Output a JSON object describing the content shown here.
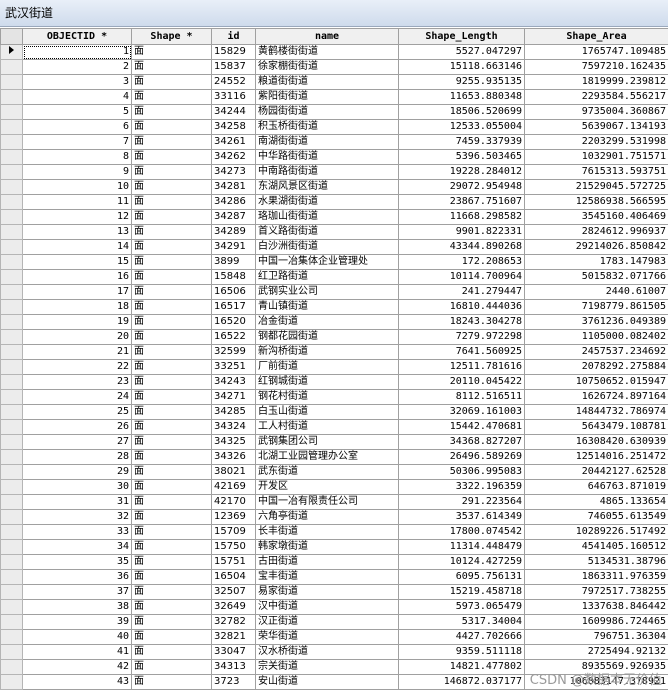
{
  "window": {
    "title": "武汉街道"
  },
  "columns": [
    "OBJECTID *",
    "Shape *",
    "id",
    "name",
    "Shape_Length",
    "Shape_Area"
  ],
  "rows": [
    {
      "oid": "1",
      "shape": "面",
      "id": "15829",
      "name": "黄鹤楼街街道",
      "len": "5527.047297",
      "area": "1765747.109485"
    },
    {
      "oid": "2",
      "shape": "面",
      "id": "15837",
      "name": "徐家棚街街道",
      "len": "15118.663146",
      "area": "7597210.162435"
    },
    {
      "oid": "3",
      "shape": "面",
      "id": "24552",
      "name": "粮道街街道",
      "len": "9255.935135",
      "area": "1819999.239812"
    },
    {
      "oid": "4",
      "shape": "面",
      "id": "33116",
      "name": "紫阳街街道",
      "len": "11653.880348",
      "area": "2293584.556217"
    },
    {
      "oid": "5",
      "shape": "面",
      "id": "34244",
      "name": "杨园街街道",
      "len": "18506.520699",
      "area": "9735004.360867"
    },
    {
      "oid": "6",
      "shape": "面",
      "id": "34258",
      "name": "积玉桥街街道",
      "len": "12533.055004",
      "area": "5639067.134193"
    },
    {
      "oid": "7",
      "shape": "面",
      "id": "34261",
      "name": "南湖街街道",
      "len": "7459.337939",
      "area": "2203299.531998"
    },
    {
      "oid": "8",
      "shape": "面",
      "id": "34262",
      "name": "中华路街街道",
      "len": "5396.503465",
      "area": "1032901.751571"
    },
    {
      "oid": "9",
      "shape": "面",
      "id": "34273",
      "name": "中南路街街道",
      "len": "19228.284012",
      "area": "7615313.593751"
    },
    {
      "oid": "10",
      "shape": "面",
      "id": "34281",
      "name": "东湖风景区街道",
      "len": "29072.954948",
      "area": "21529045.572725"
    },
    {
      "oid": "11",
      "shape": "面",
      "id": "34286",
      "name": "水果湖街街道",
      "len": "23867.751607",
      "area": "12586938.566595"
    },
    {
      "oid": "12",
      "shape": "面",
      "id": "34287",
      "name": "珞珈山街街道",
      "len": "11668.298582",
      "area": "3545160.406469"
    },
    {
      "oid": "13",
      "shape": "面",
      "id": "34289",
      "name": "首义路街街道",
      "len": "9901.822331",
      "area": "2824612.996937"
    },
    {
      "oid": "14",
      "shape": "面",
      "id": "34291",
      "name": "白沙洲街街道",
      "len": "43344.890268",
      "area": "29214026.850842"
    },
    {
      "oid": "15",
      "shape": "面",
      "id": "3899",
      "name": "中国一冶集体企业管理处",
      "len": "172.208653",
      "area": "1783.147983"
    },
    {
      "oid": "16",
      "shape": "面",
      "id": "15848",
      "name": "红卫路街道",
      "len": "10114.700964",
      "area": "5015832.071766"
    },
    {
      "oid": "17",
      "shape": "面",
      "id": "16506",
      "name": "武钢实业公司",
      "len": "241.279447",
      "area": "2440.61007"
    },
    {
      "oid": "18",
      "shape": "面",
      "id": "16517",
      "name": "青山镇街道",
      "len": "16810.444036",
      "area": "7198779.861505"
    },
    {
      "oid": "19",
      "shape": "面",
      "id": "16520",
      "name": "冶金街道",
      "len": "18243.304278",
      "area": "3761236.049389"
    },
    {
      "oid": "20",
      "shape": "面",
      "id": "16522",
      "name": "钢都花园街道",
      "len": "7279.972298",
      "area": "1105000.082402"
    },
    {
      "oid": "21",
      "shape": "面",
      "id": "32599",
      "name": "新沟桥街道",
      "len": "7641.560925",
      "area": "2457537.234692"
    },
    {
      "oid": "22",
      "shape": "面",
      "id": "33251",
      "name": "厂前街道",
      "len": "12511.781616",
      "area": "2078292.275884"
    },
    {
      "oid": "23",
      "shape": "面",
      "id": "34243",
      "name": "红钢城街道",
      "len": "20110.045422",
      "area": "10750652.015947"
    },
    {
      "oid": "24",
      "shape": "面",
      "id": "34271",
      "name": "钢花村街道",
      "len": "8112.516511",
      "area": "1626724.897164"
    },
    {
      "oid": "25",
      "shape": "面",
      "id": "34285",
      "name": "白玉山街道",
      "len": "32069.161003",
      "area": "14844732.786974"
    },
    {
      "oid": "26",
      "shape": "面",
      "id": "34324",
      "name": "工人村街道",
      "len": "15442.470681",
      "area": "5643479.108781"
    },
    {
      "oid": "27",
      "shape": "面",
      "id": "34325",
      "name": "武钢集团公司",
      "len": "34368.827207",
      "area": "16308420.630939"
    },
    {
      "oid": "28",
      "shape": "面",
      "id": "34326",
      "name": "北湖工业园管理办公室",
      "len": "26496.589269",
      "area": "12514016.251472"
    },
    {
      "oid": "29",
      "shape": "面",
      "id": "38021",
      "name": "武东街道",
      "len": "50306.995083",
      "area": "20442127.62528"
    },
    {
      "oid": "30",
      "shape": "面",
      "id": "42169",
      "name": "开发区",
      "len": "3322.196359",
      "area": "646763.871019"
    },
    {
      "oid": "31",
      "shape": "面",
      "id": "42170",
      "name": "中国一冶有限责任公司",
      "len": "291.223564",
      "area": "4865.133654"
    },
    {
      "oid": "32",
      "shape": "面",
      "id": "12369",
      "name": "六角亭街道",
      "len": "3537.614349",
      "area": "746055.613549"
    },
    {
      "oid": "33",
      "shape": "面",
      "id": "15709",
      "name": "长丰街道",
      "len": "17800.074542",
      "area": "10289226.517492"
    },
    {
      "oid": "34",
      "shape": "面",
      "id": "15750",
      "name": "韩家墩街道",
      "len": "11314.448479",
      "area": "4541405.160512"
    },
    {
      "oid": "35",
      "shape": "面",
      "id": "15751",
      "name": "古田街道",
      "len": "10124.427259",
      "area": "5134531.38796"
    },
    {
      "oid": "36",
      "shape": "面",
      "id": "16504",
      "name": "宝丰街道",
      "len": "6095.756131",
      "area": "1863311.976359"
    },
    {
      "oid": "37",
      "shape": "面",
      "id": "32507",
      "name": "易家街道",
      "len": "15219.458718",
      "area": "7972517.738255"
    },
    {
      "oid": "38",
      "shape": "面",
      "id": "32649",
      "name": "汉中街道",
      "len": "5973.065479",
      "area": "1337638.846442"
    },
    {
      "oid": "39",
      "shape": "面",
      "id": "32782",
      "name": "汉正街道",
      "len": "5317.34004",
      "area": "1609986.724465"
    },
    {
      "oid": "40",
      "shape": "面",
      "id": "32821",
      "name": "荣华街道",
      "len": "4427.702666",
      "area": "796751.36304"
    },
    {
      "oid": "41",
      "shape": "面",
      "id": "33047",
      "name": "汉水桥街道",
      "len": "9359.511118",
      "area": "2725494.92132"
    },
    {
      "oid": "42",
      "shape": "面",
      "id": "34313",
      "name": "宗关街道",
      "len": "14821.477802",
      "area": "8935569.926935"
    },
    {
      "oid": "43",
      "shape": "面",
      "id": "3723",
      "name": "安山街道",
      "len": "146872.037177",
      "area": "106883147.378921"
    }
  ],
  "watermark": "CSDN @数据本无价值"
}
